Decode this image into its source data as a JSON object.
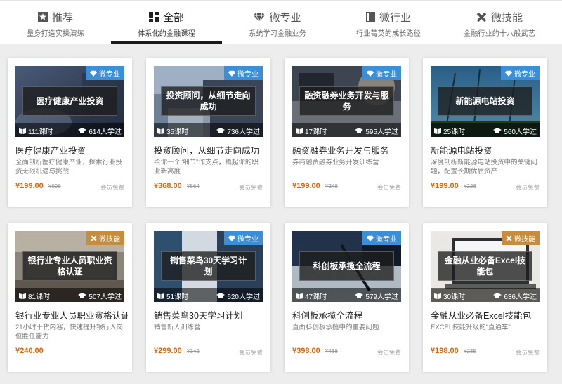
{
  "tabs": [
    {
      "title": "推荐",
      "subtitle": "量身打造实操演练",
      "icon": "star-icon"
    },
    {
      "title": "全部",
      "subtitle": "体系化的金融课程",
      "icon": "grid-icon"
    },
    {
      "title": "微专业",
      "subtitle": "系统学习金融业务",
      "icon": "diamond-icon"
    },
    {
      "title": "微行业",
      "subtitle": "行业菁英的成长路径",
      "icon": "book-icon"
    },
    {
      "title": "微技能",
      "subtitle": "金融行业的十八般武艺",
      "icon": "tools-icon"
    }
  ],
  "active_tab": "全部",
  "colors": {
    "badge_blue": "#3b8ed8",
    "badge_gold": "#c58d3d",
    "price": "#e36209"
  },
  "courses": [
    {
      "thumb_label": "医疗健康产业投资",
      "badge": "微专业",
      "badge_color": "blue",
      "lessons": "111课时",
      "learners": "614人学过",
      "title": "医疗健康产业投资",
      "desc": "全面剖析医疗健康产业，探索行业投资无限机遇与挑战",
      "price": "¥199.00",
      "old_price": "¥998",
      "member": "会员免费"
    },
    {
      "thumb_label": "投资顾问，从细节走向成功",
      "badge": "微专业",
      "badge_color": "blue",
      "lessons": "35课时",
      "learners": "736人学过",
      "title": "投资顾问，从细节走向成功",
      "desc": "给你一个“细节”作支点，撬起你的职业新高度",
      "price": "¥368.00",
      "old_price": "¥564",
      "member": "会员免费"
    },
    {
      "thumb_label": "融资融券业务开发与服务",
      "badge": "微专业",
      "badge_color": "blue",
      "lessons": "17课时",
      "learners": "595人学过",
      "title": "融资融券业务开发与服务",
      "desc": "券商融资融券业务开发训练营",
      "price": "¥199.00",
      "old_price": "¥248",
      "member": "会员免费"
    },
    {
      "thumb_label": "新能源电站投资",
      "badge": "微专业",
      "badge_color": "blue",
      "lessons": "25课时",
      "learners": "560人学过",
      "title": "新能源电站投资",
      "desc": "深度剖析新能源电站投资中的关键问题，配置长期优质资产",
      "price": "¥199.00",
      "old_price": "¥226",
      "member": "会员免费"
    },
    {
      "thumb_label": "银行业专业人员职业资格认证",
      "badge": "微技能",
      "badge_color": "gold",
      "lessons": "81课时",
      "learners": "507人学过",
      "title": "银行业专业人员职业资格认证",
      "desc": "21小时干货内容，快速提升银行人岗位胜任能力",
      "price": "¥240.00",
      "old_price": "",
      "member": ""
    },
    {
      "thumb_label": "销售菜鸟30天学习计划",
      "badge": "微专业",
      "badge_color": "blue",
      "lessons": "51课时",
      "learners": "620人学过",
      "title": "销售菜鸟30天学习计划",
      "desc": "销售新人训练营",
      "price": "¥299.00",
      "old_price": "¥342",
      "member": "会员免费"
    },
    {
      "thumb_label": "科创板承揽全流程",
      "badge": "微专业",
      "badge_color": "blue",
      "lessons": "47课时",
      "learners": "579人学过",
      "title": "科创板承揽全流程",
      "desc": "直面科创板承揽中的重要问题",
      "price": "¥398.00",
      "old_price": "¥468",
      "member": "会员免费"
    },
    {
      "thumb_label": "金融从业必备Excel技能包",
      "badge": "微技能",
      "badge_color": "gold",
      "lessons": "30课时",
      "learners": "636人学过",
      "title": "金融从业必备Excel技能包",
      "desc": "EXCEL技能升级的“直通车”",
      "price": "¥198.00",
      "old_price": "¥235",
      "member": "会员免费"
    }
  ]
}
